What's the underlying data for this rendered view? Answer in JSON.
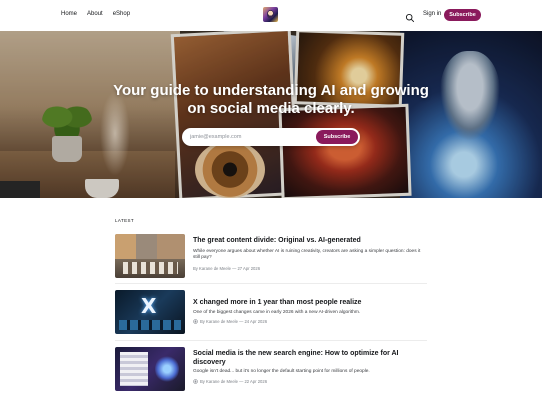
{
  "header": {
    "nav": [
      "Home",
      "About",
      "eShop"
    ],
    "signin_label": "Sign in",
    "subscribe_label": "Subscribe",
    "search_icon": "search-icon",
    "accent_color": "#8a1a5c"
  },
  "hero": {
    "title": "Your guide to understanding AI and growing on social media clearly.",
    "email_placeholder": "jamie@example.com",
    "subscribe_label": "Subscribe"
  },
  "feed": {
    "section_label": "LATEST",
    "posts": [
      {
        "title": "The great content divide: Original vs. AI-generated",
        "excerpt": "While everyone argues about whether AI is ruining creativity, creators are asking a simpler question: does it still pay?",
        "meta": "By Karane de Meele — 27 Apr 2026",
        "locked": false
      },
      {
        "title": "X changed more in 1 year than most people realize",
        "excerpt": "One of the biggest changes came in early 2026 with a new AI-driven algorithm.",
        "meta": "By Karane de Meele — 24 Apr 2026",
        "locked": true
      },
      {
        "title": "Social media is the new search engine: How to optimize for AI discovery",
        "excerpt": "Google isn't dead... but it's no longer the default starting point for millions of people.",
        "meta": "By Karane de Meele — 22 Apr 2026",
        "locked": true
      }
    ]
  }
}
